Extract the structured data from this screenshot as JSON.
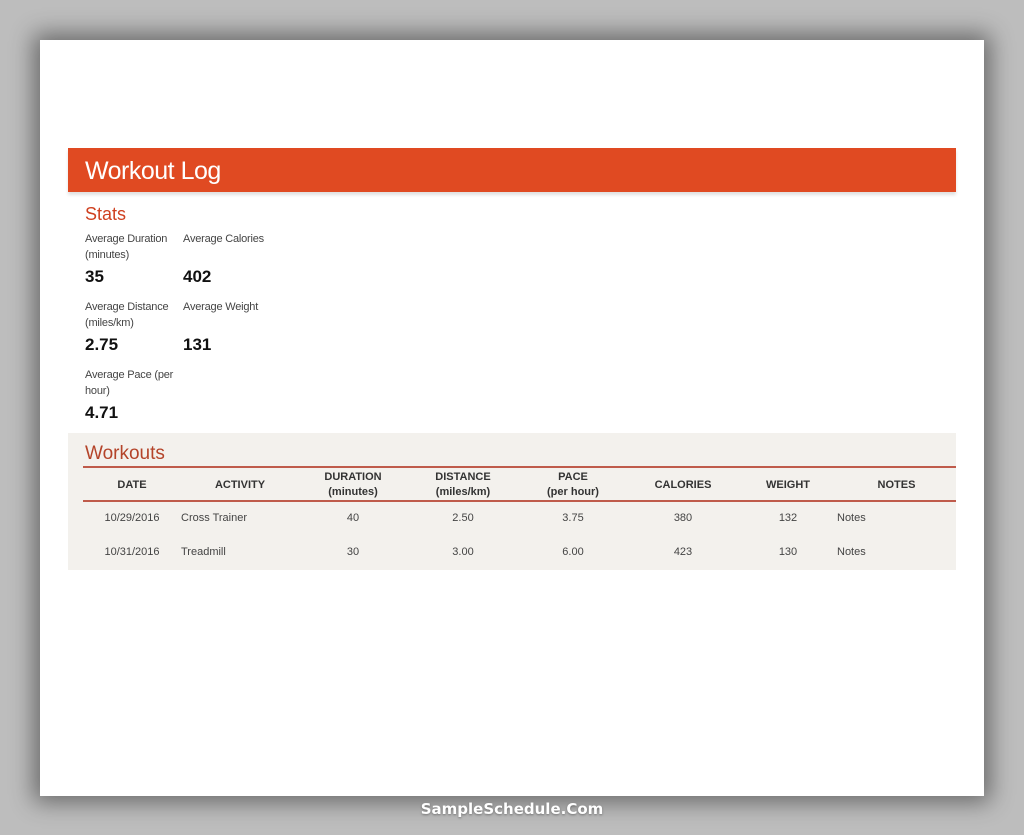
{
  "title": "Workout Log",
  "stats": {
    "heading": "Stats",
    "items": [
      {
        "label": "Average Duration (minutes)",
        "value": "35"
      },
      {
        "label": "Average Calories",
        "value": "402"
      },
      {
        "label": "Average Distance (miles/km)",
        "value": "2.75"
      },
      {
        "label": "Average Weight",
        "value": "131"
      },
      {
        "label": "Average Pace (per hour)",
        "value": "4.71"
      }
    ]
  },
  "workouts": {
    "heading": "Workouts",
    "columns": [
      {
        "line1": "DATE",
        "line2": ""
      },
      {
        "line1": "ACTIVITY",
        "line2": ""
      },
      {
        "line1": "DURATION",
        "line2": "(minutes)"
      },
      {
        "line1": "DISTANCE",
        "line2": "(miles/km)"
      },
      {
        "line1": "PACE",
        "line2": "(per hour)"
      },
      {
        "line1": "CALORIES",
        "line2": ""
      },
      {
        "line1": "WEIGHT",
        "line2": ""
      },
      {
        "line1": "NOTES",
        "line2": ""
      }
    ],
    "rows": [
      {
        "date": "10/29/2016",
        "activity": "Cross Trainer",
        "duration": "40",
        "distance": "2.50",
        "pace": "3.75",
        "calories": "380",
        "weight": "132",
        "notes": "Notes"
      },
      {
        "date": "10/31/2016",
        "activity": "Treadmill",
        "duration": "30",
        "distance": "3.00",
        "pace": "6.00",
        "calories": "423",
        "weight": "130",
        "notes": "Notes"
      }
    ]
  },
  "footer": {
    "watermark": "SampleSchedule.Com"
  },
  "colors": {
    "accent": "#e04a22",
    "heading": "#cf4020",
    "rule": "#bf5b4b",
    "section_bg": "#f3f1ed"
  }
}
